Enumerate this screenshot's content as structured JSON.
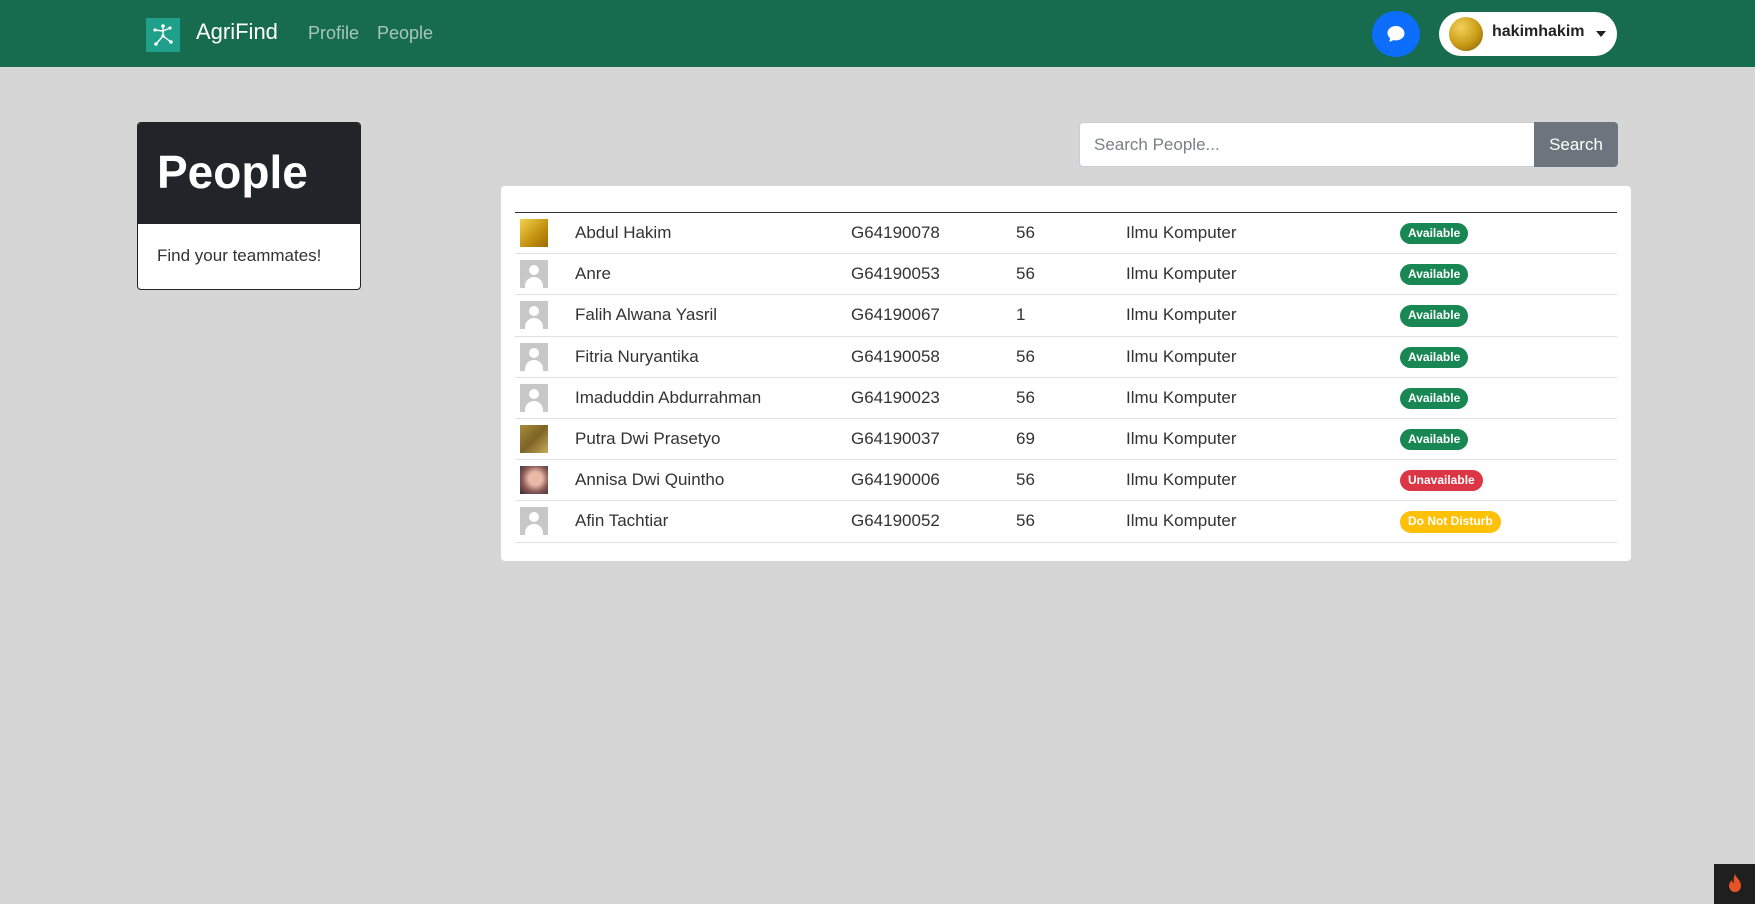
{
  "navbar": {
    "brand": "AgriFind",
    "links": [
      {
        "label": "Profile"
      },
      {
        "label": "People"
      }
    ],
    "user": {
      "name": "hakimhakim"
    },
    "colors": {
      "background": "#176b4e",
      "chat_button": "#0d6efd"
    }
  },
  "sidebar": {
    "title": "People",
    "subtitle": "Find your teammates!"
  },
  "search": {
    "placeholder": "Search People...",
    "value": "",
    "button_label": "Search"
  },
  "people": {
    "rows": [
      {
        "avatar": "gold-avatar",
        "name": "Abdul Hakim",
        "nim": "G64190078",
        "number": "56",
        "department": "Ilmu Komputer",
        "status": "Available",
        "status_color": "#198754"
      },
      {
        "avatar": "default-avatar",
        "name": "Anre",
        "nim": "G64190053",
        "number": "56",
        "department": "Ilmu Komputer",
        "status": "Available",
        "status_color": "#198754"
      },
      {
        "avatar": "default-avatar",
        "name": "Falih Alwana Yasril",
        "nim": "G64190067",
        "number": "1",
        "department": "Ilmu Komputer",
        "status": "Available",
        "status_color": "#198754"
      },
      {
        "avatar": "default-avatar",
        "name": "Fitria Nuryantika",
        "nim": "G64190058",
        "number": "56",
        "department": "Ilmu Komputer",
        "status": "Available",
        "status_color": "#198754"
      },
      {
        "avatar": "default-avatar",
        "name": "Imaduddin Abdurrahman",
        "nim": "G64190023",
        "number": "56",
        "department": "Ilmu Komputer",
        "status": "Available",
        "status_color": "#198754"
      },
      {
        "avatar": "olive-avatar",
        "name": "Putra Dwi Prasetyo",
        "nim": "G64190037",
        "number": "69",
        "department": "Ilmu Komputer",
        "status": "Available",
        "status_color": "#198754"
      },
      {
        "avatar": "photo-avatar",
        "name": "Annisa Dwi Quintho",
        "nim": "G64190006",
        "number": "56",
        "department": "Ilmu Komputer",
        "status": "Unavailable",
        "status_color": "#dc3545"
      },
      {
        "avatar": "default-avatar",
        "name": "Afin Tachtiar",
        "nim": "G64190052",
        "number": "56",
        "department": "Ilmu Komputer",
        "status": "Do Not Disturb",
        "status_color": "#ffc107"
      }
    ]
  },
  "icons": {
    "brand_logo": "network-logo-icon",
    "chat": "chat-bubble-icon",
    "user_menu": "caret-down-icon",
    "corner": "flame-icon"
  }
}
